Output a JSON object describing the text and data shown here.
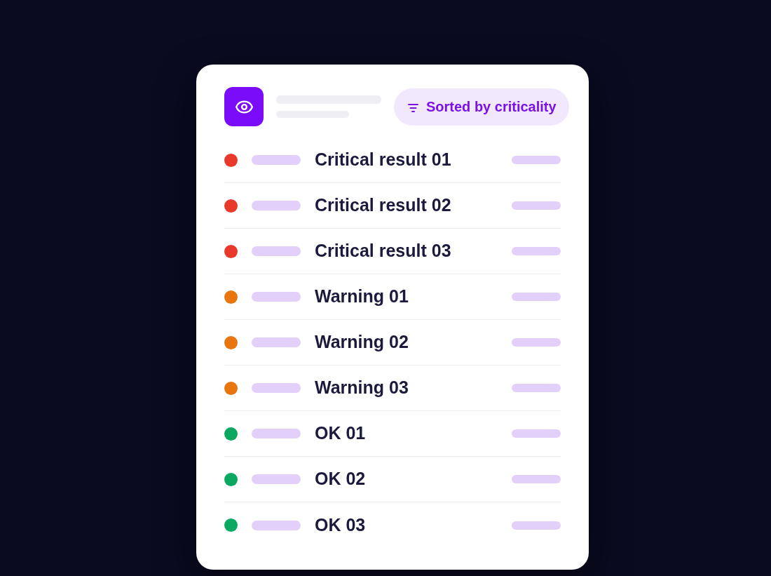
{
  "header": {
    "sort_label": "Sorted by criticality"
  },
  "rows": [
    {
      "title": "Critical result 01",
      "color": "#e8392a"
    },
    {
      "title": "Critical result 02",
      "color": "#e8392a"
    },
    {
      "title": "Critical result 03",
      "color": "#e8392a"
    },
    {
      "title": "Warning 01",
      "color": "#e8760f"
    },
    {
      "title": "Warning 02",
      "color": "#e8760f"
    },
    {
      "title": "Warning 03",
      "color": "#e8760f"
    },
    {
      "title": "OK 01",
      "color": "#0aa861"
    },
    {
      "title": "OK 02",
      "color": "#0aa861"
    },
    {
      "title": "OK 03",
      "color": "#0aa861"
    }
  ]
}
